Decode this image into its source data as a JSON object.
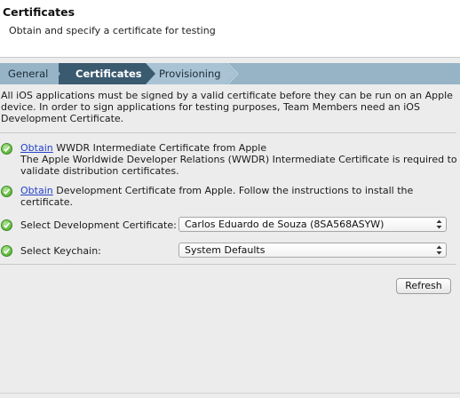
{
  "header": {
    "title": "Certificates",
    "subtitle": "Obtain and specify a certificate for testing"
  },
  "breadcrumb": {
    "items": [
      {
        "label": "General",
        "active": false
      },
      {
        "label": "Certificates",
        "active": true
      },
      {
        "label": "Provisioning",
        "active": false
      }
    ]
  },
  "intro": {
    "line1": "All iOS applications must be signed by a valid certificate before they can be run on an Apple",
    "line2": "device. In order to sign applications for testing purposes, Team Members need an iOS",
    "line3": "Development Certificate."
  },
  "steps": {
    "wwdr": {
      "link": "Obtain",
      "title_rest": " WWDR Intermediate Certificate from Apple",
      "desc1": "The Apple Worldwide Developer Relations (WWDR) Intermediate Certificate is required to",
      "desc2": "validate distribution certificates."
    },
    "dev": {
      "link": "Obtain",
      "text_rest": " Development Certificate from Apple. Follow the instructions to install the",
      "text2": "certificate."
    },
    "select_cert": {
      "label": "Select Development Certificate:",
      "value": "Carlos Eduardo de Souza (8SA568ASYW)"
    },
    "select_keychain": {
      "label": "Select Keychain:",
      "value": "System Defaults"
    }
  },
  "actions": {
    "refresh_label": "Refresh"
  },
  "colors": {
    "crumb_active": "#3a5a70",
    "crumb_inactive": "#97b4c7",
    "check_green": "#6dc24a",
    "link_blue": "#2443c9"
  }
}
